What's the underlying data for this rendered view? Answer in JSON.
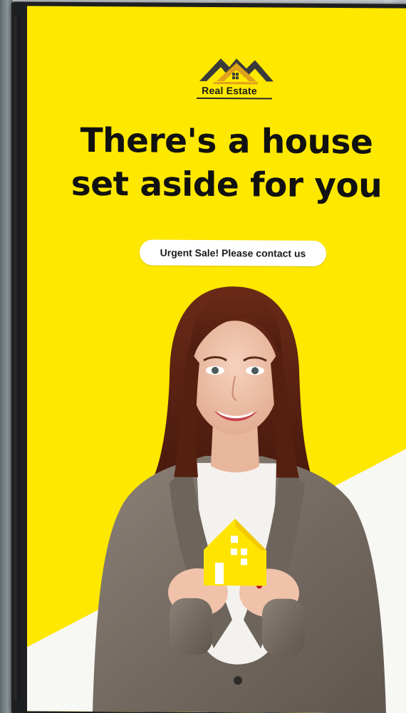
{
  "brand": {
    "logo_caption": "Real Estate",
    "logo_icon": "house-roof-icon"
  },
  "headline": {
    "line1": "There's a house",
    "line2": "set aside for you"
  },
  "cta": {
    "label": "Urgent Sale! Please contact us"
  },
  "colors": {
    "background": "#ffe800",
    "accent_gold": "#e0a21a",
    "text_dark": "#111111",
    "cta_background": "#ffffff",
    "frame": "#1e1f21"
  },
  "photo": {
    "subject": "smiling-woman-holding-house-model",
    "prop_icon": "yellow-house-model-icon"
  }
}
